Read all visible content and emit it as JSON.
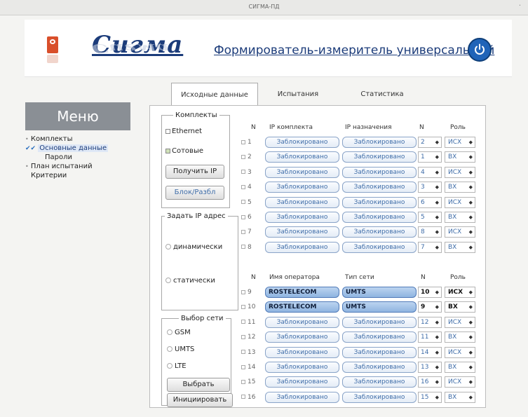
{
  "window": {
    "title": "СИГМА-ПД"
  },
  "header": {
    "logo_text": "Сигма",
    "tagline": "Формирователь-измеритель универсальный"
  },
  "tabs": [
    {
      "label": "Исходные данные",
      "active": true
    },
    {
      "label": "Испытания",
      "active": false
    },
    {
      "label": "Статистика",
      "active": false
    }
  ],
  "menu": {
    "title": "Меню",
    "items": [
      {
        "label": "Комплекты",
        "marker": "•",
        "indent": 0,
        "selected": false
      },
      {
        "label": "Основные данные",
        "marker": "✔✔",
        "indent": 0,
        "selected": true
      },
      {
        "label": "Пароли",
        "marker": "",
        "indent": 1,
        "selected": false
      },
      {
        "label": "План испытаний",
        "marker": "•",
        "indent": 0,
        "selected": false
      },
      {
        "label": "Критерии",
        "marker": "",
        "indent": 0,
        "selected": false
      }
    ]
  },
  "complects": {
    "legend": "Комплекты",
    "ethernet": {
      "label": "Ethernet",
      "checked": false
    },
    "cellular": {
      "label": "Сотовые",
      "checked": true
    },
    "get_ip_btn": "Получить IP",
    "block_btn": "Блок/Разбл"
  },
  "set_ip": {
    "legend": "Задать IP адрес",
    "dynamic": "динамически",
    "static": "статически"
  },
  "net_select": {
    "legend": "Выбор сети",
    "options": [
      "GSM",
      "UMTS",
      "LTE"
    ],
    "select_btn": "Выбрать",
    "init_btn": "Инициировать"
  },
  "table1": {
    "headers": {
      "n": "N",
      "ip_complect": "IP комплекта",
      "ip_dest": "IP назначения",
      "n2": "N",
      "role": "Роль"
    },
    "rows": [
      {
        "n": "1",
        "ip1": "Заблокировано",
        "ip2": "Заблокировано",
        "num": "2",
        "role": "ИСХ"
      },
      {
        "n": "2",
        "ip1": "Заблокировано",
        "ip2": "Заблокировано",
        "num": "1",
        "role": "ВХ"
      },
      {
        "n": "3",
        "ip1": "Заблокировано",
        "ip2": "Заблокировано",
        "num": "4",
        "role": "ИСХ"
      },
      {
        "n": "4",
        "ip1": "Заблокировано",
        "ip2": "Заблокировано",
        "num": "3",
        "role": "ВХ"
      },
      {
        "n": "5",
        "ip1": "Заблокировано",
        "ip2": "Заблокировано",
        "num": "6",
        "role": "ИСХ"
      },
      {
        "n": "6",
        "ip1": "Заблокировано",
        "ip2": "Заблокировано",
        "num": "5",
        "role": "ВХ"
      },
      {
        "n": "7",
        "ip1": "Заблокировано",
        "ip2": "Заблокировано",
        "num": "8",
        "role": "ИСХ"
      },
      {
        "n": "8",
        "ip1": "Заблокировано",
        "ip2": "Заблокировано",
        "num": "7",
        "role": "ВХ"
      }
    ]
  },
  "table2": {
    "headers": {
      "n": "N",
      "operator": "Имя оператора",
      "net_type": "Тип сети",
      "n2": "N",
      "role": "Роль"
    },
    "rows": [
      {
        "n": "9",
        "op": "ROSTELECOM",
        "net": "UMTS",
        "num": "10",
        "role": "ИСХ",
        "active": true
      },
      {
        "n": "10",
        "op": "ROSTELECOM",
        "net": "UMTS",
        "num": "9",
        "role": "ВХ",
        "active": true
      },
      {
        "n": "11",
        "op": "Заблокировано",
        "net": "Заблокировано",
        "num": "12",
        "role": "ИСХ",
        "active": false
      },
      {
        "n": "12",
        "op": "Заблокировано",
        "net": "Заблокировано",
        "num": "11",
        "role": "ВХ",
        "active": false
      },
      {
        "n": "13",
        "op": "Заблокировано",
        "net": "Заблокировано",
        "num": "14",
        "role": "ИСХ",
        "active": false
      },
      {
        "n": "14",
        "op": "Заблокировано",
        "net": "Заблокировано",
        "num": "13",
        "role": "ВХ",
        "active": false
      },
      {
        "n": "15",
        "op": "Заблокировано",
        "net": "Заблокировано",
        "num": "16",
        "role": "ИСХ",
        "active": false
      },
      {
        "n": "16",
        "op": "Заблокировано",
        "net": "Заблокировано",
        "num": "15",
        "role": "ВХ",
        "active": false
      }
    ]
  },
  "colors": {
    "brand": "#1c3c7a",
    "accent": "#2064b8",
    "logo": "#d94f2b",
    "menu_bg": "#8a8f95"
  }
}
